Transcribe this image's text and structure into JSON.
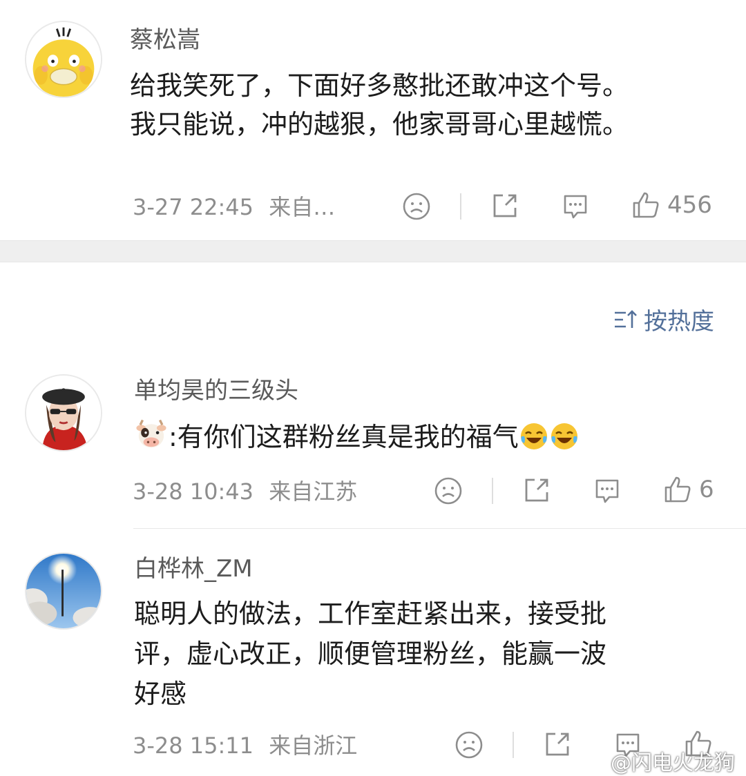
{
  "comments": [
    {
      "username": "蔡松嵩",
      "text_lines": [
        "给我笑死了，下面好多憨批还敢冲这个号。",
        "我只能说，冲的越狠，他家哥哥心里越慌。"
      ],
      "time": "3-27 22:45",
      "source": "来自…",
      "likes": "456",
      "avatar_icon": "psyduck-avatar"
    },
    {
      "username": "单均昊的三级头",
      "text": ":有你们这群粉丝真是我的福气",
      "time": "3-28 10:43",
      "source": "来自江苏",
      "likes": "6",
      "avatar_icon": "girl-beret-avatar",
      "emoji_icons": [
        "cow-emoji",
        "laugh-cry-emoji",
        "laugh-cry-emoji"
      ]
    },
    {
      "username": "白桦林_ZM",
      "text_lines": [
        "聪明人的做法，工作室赶紧出来，接受批",
        "评，虚心改正，顺便管理粉丝，能赢一波",
        "好感"
      ],
      "time": "3-28 15:11",
      "source": "来自浙江",
      "likes": "",
      "avatar_icon": "sky-sun-avatar"
    }
  ],
  "sort": {
    "label": "按热度",
    "icon": "sort-icon"
  },
  "watermark": {
    "text": "@闪电火龙狗",
    "icon": "weibo-logo"
  },
  "colors": {
    "link_blue": "#53709a",
    "meta_gray": "#8d8d8d",
    "gap_gray": "#efefef"
  }
}
